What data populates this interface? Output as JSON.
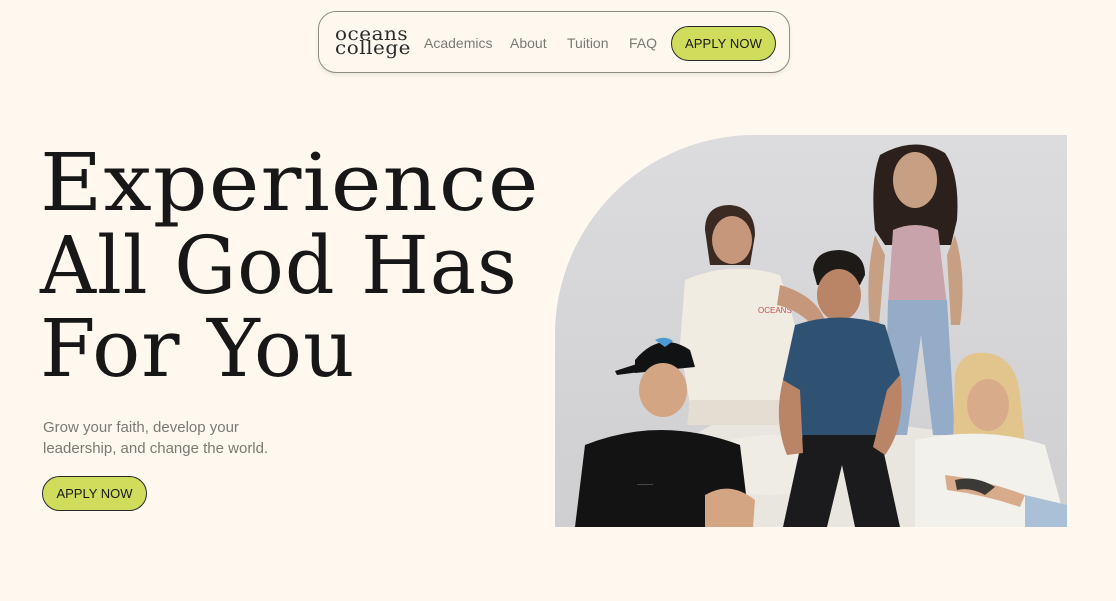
{
  "nav": {
    "logo": {
      "line1": "oceans",
      "line2": "college"
    },
    "links": [
      {
        "label": "Academics"
      },
      {
        "label": "About"
      },
      {
        "label": "Tuition"
      },
      {
        "label": "FAQ"
      }
    ],
    "apply_label": "APPLY NOW"
  },
  "hero": {
    "title_lines": [
      "Experience",
      "All God Has",
      "For You"
    ],
    "subtitle": "Grow your faith, develop your leadership, and change the world.",
    "apply_label": "APPLY NOW",
    "photo": {
      "shirt_text": "OCEANS"
    }
  },
  "colors": {
    "background": "#fff8ef",
    "accent": "#cfdc5c",
    "text_dark": "#171717",
    "text_muted": "#7a7a72"
  }
}
